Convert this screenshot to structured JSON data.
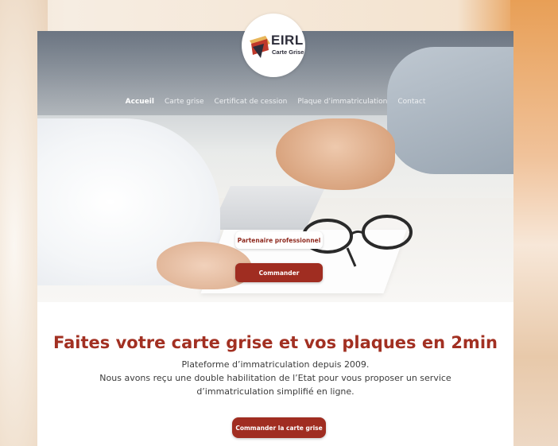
{
  "logo": {
    "title": "EIRL",
    "subtitle": "Carte Grise"
  },
  "nav": {
    "items": [
      {
        "label": "Accueil",
        "active": true
      },
      {
        "label": "Carte grise",
        "active": false
      },
      {
        "label": "Certificat de cession",
        "active": false
      },
      {
        "label": "Plaque d’immatriculation",
        "active": false
      },
      {
        "label": "Contact",
        "active": false
      }
    ]
  },
  "hero": {
    "partner_label": "Partenaire professionnel",
    "order_label": "Commander"
  },
  "main": {
    "headline": "Faites votre carte grise et vos plaques en 2min",
    "description_lines": [
      "Plateforme d’immatriculation depuis 2009.",
      "Nous avons reçu une double habilitation de l’Etat pour vous proposer un service",
      "d’immatriculation simplifié en ligne."
    ],
    "cta_label": "Commander la carte grise"
  },
  "colors": {
    "brand_red": "#a02d21",
    "headline_red": "#a23022"
  }
}
